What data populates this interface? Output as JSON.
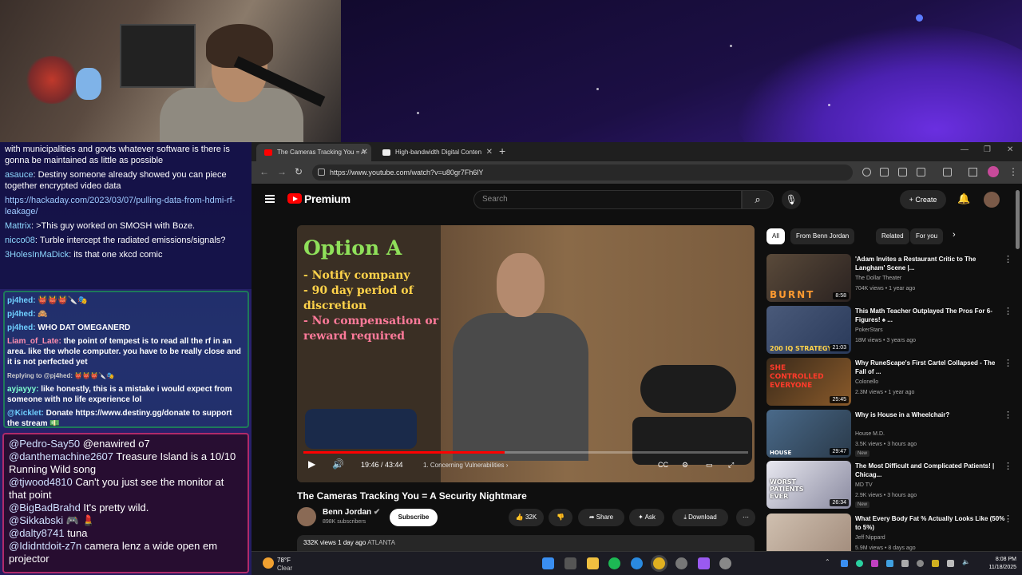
{
  "browser": {
    "tabs": [
      {
        "label": "The Cameras Tracking You = A"
      },
      {
        "label": "High-bandwidth Digital Conten"
      }
    ],
    "url": "https://www.youtube.com/watch?v=u80gr7Fh6lY"
  },
  "youtube": {
    "brand": "Premium",
    "search_placeholder": "Search",
    "create_label": "Create",
    "player": {
      "overlay_title": "Option A",
      "bullets": [
        "- Notify company",
        "- 90 day period of discretion",
        "- No compensation or reward required"
      ],
      "time": "19:46 / 43:44",
      "chapter": "1. Concerning Vulnerabilities",
      "progress": 0.452
    },
    "video": {
      "title": "The Cameras Tracking You = A Security Nightmare",
      "channel": "Benn Jordan",
      "subscribers": "898K subscribers",
      "subscribe_label": "Subscribe",
      "likes": "32K",
      "share_label": "Share",
      "ask_label": "Ask",
      "download_label": "Download",
      "views": "332K views",
      "age": "1 day ago",
      "location": "ATLANTA"
    },
    "chips": [
      "All",
      "From Benn Jordan",
      "Related",
      "For you"
    ],
    "recommendations": [
      {
        "title": "'Adam Invites a Restaurant Critic to The Langham' Scene |...",
        "channel": "The Dollar Theater",
        "meta": "704K views • 1 year ago",
        "duration": "8:58",
        "thumb_text": "BURNT",
        "badge": ""
      },
      {
        "title": "This Math Teacher Outplayed The Pros For 6-Figures! ♠ ...",
        "channel": "PokerStars",
        "meta": "18M views • 3 years ago",
        "duration": "21:03",
        "thumb_text": "200 IQ STRATEGY",
        "badge": ""
      },
      {
        "title": "Why RuneScape's First Cartel Collapsed - The Fall of ...",
        "channel": "Colonello",
        "meta": "2.3M views • 1 year ago",
        "duration": "25:45",
        "thumb_text": "SHE CONTROLLED EVERYONE",
        "badge": ""
      },
      {
        "title": "Why is House in a Wheelchair?",
        "channel": "House M.D.",
        "meta": "3.5K views • 3 hours ago",
        "duration": "29:47",
        "thumb_text": "HOUSE",
        "badge": "New"
      },
      {
        "title": "The Most Difficult and Complicated Patients! | Chicag...",
        "channel": "MD TV",
        "meta": "2.9K views • 3 hours ago",
        "duration": "26:34",
        "thumb_text": "WORST PATIENTS EVER",
        "badge": "New"
      },
      {
        "title": "What Every Body Fat % Actually Looks Like (50% to 5%)",
        "channel": "Jeff Nippard",
        "meta": "5.9M views • 8 days ago",
        "duration": "",
        "thumb_text": "",
        "badge": ""
      }
    ]
  },
  "chat": {
    "top": [
      {
        "user": "",
        "text": "with municipalities and govts whatever software is there is gonna be maintained as little as possible"
      },
      {
        "user": "asauce",
        "text": ": Destiny someone already showed you can piece together encrypted video data"
      },
      {
        "user": "",
        "text": "https://hackaday.com/2023/03/07/pulling-data-from-hdmi-rf-leakage/"
      },
      {
        "user": "Mattrix",
        "text": ": >This guy worked on SMOSH with Boze."
      },
      {
        "user": "nicco08",
        "text": ": Turble intercept the radiated emissions/signals?"
      },
      {
        "user": "3HolesInMaDick",
        "text": ": its that one xkcd comic"
      }
    ],
    "mid": [
      {
        "user": "pj4hed:",
        "text": "👹👹👹🔪🎭"
      },
      {
        "user": "pj4hed:",
        "text": "🙈"
      },
      {
        "user": "pj4hed:",
        "text": "WHO DAT OMEGANERD"
      },
      {
        "user": "Liam_of_Late:",
        "text": "the point of tempest is to read all the rf in an area. like the whole computer. you have to be really close and it is not perfected yet"
      },
      {
        "user": "Replying to @pj4hed:",
        "text": "👹👹👹🔪🎭"
      },
      {
        "user": "ayjayyy:",
        "text": "like honestly, this is a mistake i would expect from someone with no life experience lol"
      },
      {
        "user": "@Kicklet:",
        "text": "Donate https://www.destiny.gg/donate to support the stream 💵"
      }
    ],
    "bottom": [
      {
        "user": "@Pedro-Say50",
        "text": " @enawired o7"
      },
      {
        "user": "@danthemachine2607",
        "text": " Treasure Island is a 10/10 Running Wild song"
      },
      {
        "user": "@tjwood4810",
        "text": " Can't you just see the monitor at that point"
      },
      {
        "user": "@BigBadBrahd",
        "text": " It's pretty wild."
      },
      {
        "user": "@Sikkabski",
        "text": " 🎮 💄"
      },
      {
        "user": "@dalty8741",
        "text": " tuna"
      },
      {
        "user": "@Ididntdoit-z7n",
        "text": " camera lenz a wide open em projector"
      }
    ]
  },
  "taskbar": {
    "temp": "78°F",
    "condition": "Clear",
    "time": "8:08 PM",
    "date": "11/18/2025"
  },
  "colors": {
    "yt_red": "#ff0000",
    "chip_active": "#ffffff",
    "chat_bg": "#241d60"
  }
}
